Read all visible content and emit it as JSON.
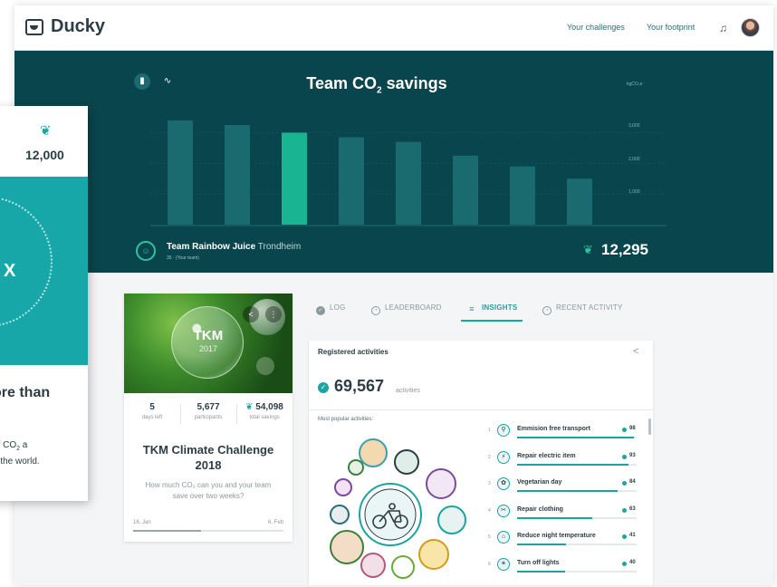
{
  "header": {
    "brand": "Ducky",
    "nav": [
      "Your challenges",
      "Your footprint"
    ]
  },
  "hero": {
    "title_prefix": "Team CO",
    "title_sub": "2",
    "title_suffix": " savings",
    "unit": "kgCO₂e",
    "yticks": [
      "3,000",
      "2,000",
      "1,000"
    ],
    "team_name": "Team Rainbow Juice",
    "team_city": "Trondheim",
    "team_sub": "35 · (Your team)",
    "team_total": "12,295"
  },
  "chart_data": {
    "type": "bar",
    "title": "Team CO₂ savings",
    "ylabel": "kgCO₂e",
    "ylim": [
      0,
      3900
    ],
    "yticks": [
      1000,
      2000,
      3000
    ],
    "values": [
      3400,
      3250,
      3000,
      2850,
      2700,
      2250,
      1900,
      1500
    ],
    "highlight_index": 2,
    "colors": {
      "bar": "#1a6b70",
      "highlight": "#19b592"
    }
  },
  "challenge": {
    "image_title": "TKM",
    "image_year": "2017",
    "stats": [
      {
        "value": "5",
        "label": "days left"
      },
      {
        "value": "5,677",
        "label": "participants"
      },
      {
        "value": "54,098",
        "label": "total savings"
      }
    ],
    "title_line1": "TKM Climate Challenge",
    "title_line2": "2018",
    "desc_line1": "How much CO₂ can you and your team",
    "desc_line2": "save over two weeks?",
    "date_start": "16. Jan",
    "date_end": "6. Feb",
    "progress": 0.45
  },
  "tabs": [
    {
      "label": "LOG",
      "icon": "check-circle-icon"
    },
    {
      "label": "LEADERBOARD",
      "icon": "clock-icon"
    },
    {
      "label": "INSIGHTS",
      "icon": "list-icon"
    },
    {
      "label": "RECENT ACTIVITY",
      "icon": "clock-icon"
    }
  ],
  "insights": {
    "title": "Registered activities",
    "total": "69,567",
    "total_unit": "activities",
    "popular_label": "Most popular activities:",
    "activities": [
      {
        "rank": "1",
        "name": "Emmision free transport",
        "count": "98",
        "fill": 0.98
      },
      {
        "rank": "2",
        "name": "Repair electric item",
        "count": "93",
        "fill": 0.93
      },
      {
        "rank": "3",
        "name": "Vegetarian day",
        "count": "84",
        "fill": 0.84
      },
      {
        "rank": "4",
        "name": "Repair clothing",
        "count": "63",
        "fill": 0.63
      },
      {
        "rank": "5",
        "name": "Reduce night temperature",
        "count": "41",
        "fill": 0.41
      },
      {
        "rank": "6",
        "name": "Turn off lights",
        "count": "40",
        "fill": 0.4
      }
    ]
  },
  "overlay": {
    "cut_label": "n",
    "value": "12,000",
    "x_label": "X",
    "headline": "ore than",
    "body_line1_pre": "of CO",
    "body_line1_sub": "2",
    "body_line1_post": " a",
    "body_line2": "d the world."
  }
}
